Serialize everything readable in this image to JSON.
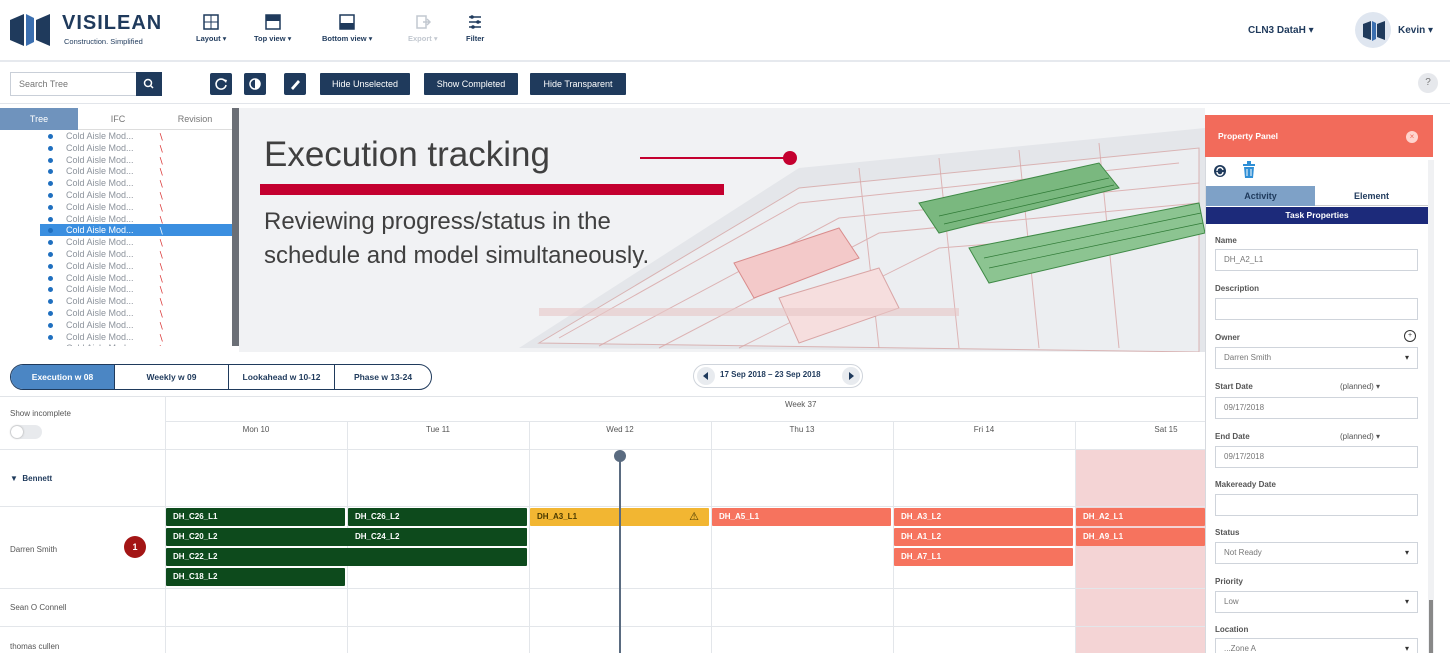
{
  "brand": {
    "name": "VISILEAN",
    "tagline": "Construction. Simplified"
  },
  "topbar": {
    "menus": [
      {
        "label": "Layout ▾",
        "icon": "layout-icon"
      },
      {
        "label": "Top view ▾",
        "icon": "top-view-icon"
      },
      {
        "label": "Bottom view ▾",
        "icon": "bottom-view-icon"
      },
      {
        "label": "Export ▾",
        "icon": "export-icon",
        "disabled": true
      },
      {
        "label": "Filter",
        "icon": "filter-icon"
      }
    ],
    "project": "CLN3 DataH ▾",
    "user": "Kevin ▾"
  },
  "toolbar": {
    "search_placeholder": "Search Tree",
    "buttons": [
      "Hide Unselected",
      "Show Completed",
      "Hide Transparent"
    ],
    "help": "?"
  },
  "tree": {
    "tabs": [
      "Tree",
      "IFC",
      "Revision"
    ],
    "active_tab": "Tree",
    "items": [
      "Cold Aisle Mod...",
      "Cold Aisle Mod...",
      "Cold Aisle Mod...",
      "Cold Aisle Mod...",
      "Cold Aisle Mod...",
      "Cold Aisle Mod...",
      "Cold Aisle Mod...",
      "Cold Aisle Mod...",
      "Cold Aisle Mod...",
      "Cold Aisle Mod...",
      "Cold Aisle Mod...",
      "Cold Aisle Mod...",
      "Cold Aisle Mod...",
      "Cold Aisle Mod...",
      "Cold Aisle Mod...",
      "Cold Aisle Mod...",
      "Cold Aisle Mod...",
      "Cold Aisle Mod...",
      "Cold Aisle Mod..."
    ],
    "selected_index": 8
  },
  "overlay": {
    "title": "Execution tracking",
    "subtitle_line1": "Reviewing progress/status in the",
    "subtitle_line2": "schedule and model simultaneously."
  },
  "view_tabs": [
    {
      "label": "Execution   w 08",
      "active": true
    },
    {
      "label": "Weekly   w 09"
    },
    {
      "label": "Lookahead   w 10-12"
    },
    {
      "label": "Phase   w 13-24"
    }
  ],
  "date_range": "17 Sep 2018 – 23 Sep 2018",
  "schedule": {
    "week": "Week 37",
    "days": [
      "Mon 10",
      "Tue 11",
      "Wed 12",
      "Thu 13",
      "Fri 14",
      "Sat 15"
    ],
    "show_incomplete": "Show incomplete",
    "group": "Bennett",
    "people": [
      "Darren Smith",
      "Sean O Connell",
      "thomas cullen"
    ],
    "badge": "1",
    "tasks": [
      {
        "label": "DH_C26_L1",
        "status": "green"
      },
      {
        "label": "DH_C20_L2",
        "status": "green"
      },
      {
        "label": "DH_C22_L2",
        "status": "green"
      },
      {
        "label": "DH_C18_L2",
        "status": "green"
      },
      {
        "label": "DH_C26_L2",
        "status": "green"
      },
      {
        "label": "DH_C24_L2",
        "status": "green"
      },
      {
        "label": "DH_A3_L1",
        "status": "yellow",
        "warning": "⚠"
      },
      {
        "label": "DH_A5_L1",
        "status": "red"
      },
      {
        "label": "DH_A3_L2",
        "status": "red"
      },
      {
        "label": "DH_A1_L2",
        "status": "red"
      },
      {
        "label": "DH_A7_L1",
        "status": "red"
      },
      {
        "label": "DH_A2_L1",
        "status": "red"
      },
      {
        "label": "DH_A9_L1",
        "status": "red"
      }
    ]
  },
  "property_panel": {
    "title": "Property Panel",
    "close": "×",
    "tabs": [
      "Activity",
      "Element"
    ],
    "section": "Task Properties",
    "fields": {
      "name_label": "Name",
      "name_value": "DH_A2_L1",
      "description_label": "Description",
      "description_value": "",
      "owner_label": "Owner",
      "owner_value": "Darren Smith",
      "start_label": "Start Date",
      "start_qual": "(planned) ▾",
      "start_value": "09/17/2018",
      "end_label": "End Date",
      "end_qual": "(planned) ▾",
      "end_value": "09/17/2018",
      "makeready_label": "Makeready Date",
      "makeready_value": "",
      "status_label": "Status",
      "status_value": "Not Ready",
      "priority_label": "Priority",
      "priority_value": "Low",
      "location_label": "Location",
      "location_value": "...Zone A"
    },
    "caret": "▾"
  },
  "colors": {
    "navy": "#1f3a5c",
    "accent_red": "#c4002f",
    "task_green": "#0d4a1c",
    "task_yellow": "#f2b632",
    "task_red": "#f6735e",
    "panel_header": "#f26b5b"
  }
}
